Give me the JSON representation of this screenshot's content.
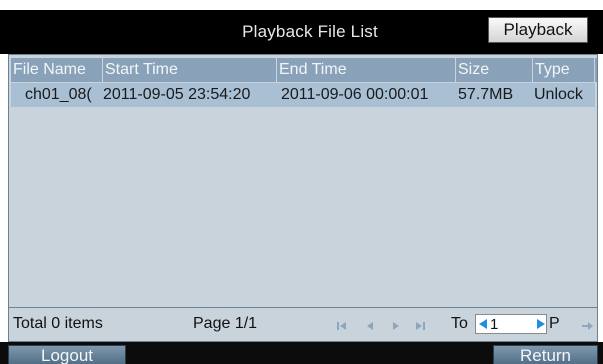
{
  "header": {
    "title": "Playback File List",
    "playback_button": "Playback"
  },
  "table": {
    "columns": [
      "File Name",
      "Start Time",
      "End Time",
      "Size",
      "Type"
    ],
    "rows": [
      [
        "ch01_08(",
        "2011-09-05 23:54:20",
        "2011-09-06 00:00:01",
        "57.7MB",
        "Unlock"
      ]
    ]
  },
  "footer": {
    "total": "Total 0 items",
    "page": "Page 1/1",
    "goto_label": "To",
    "goto_value": "1",
    "page_suffix": "P",
    "nav_icons": [
      "first-page-icon",
      "previous-page-icon",
      "next-page-icon",
      "last-page-icon",
      "arrow-right-icon"
    ]
  },
  "bottom": {
    "logout_label": "Logout",
    "return_label": "Return"
  },
  "colors": {
    "header_bg": "#000000",
    "table_bg": "#c9d3dc",
    "header_cell_bg": "#8aa2b9",
    "selected_row_bg": "#a8bfd4",
    "button_blue": "#5f7d95",
    "nav_icon": "#8ea6bb"
  }
}
